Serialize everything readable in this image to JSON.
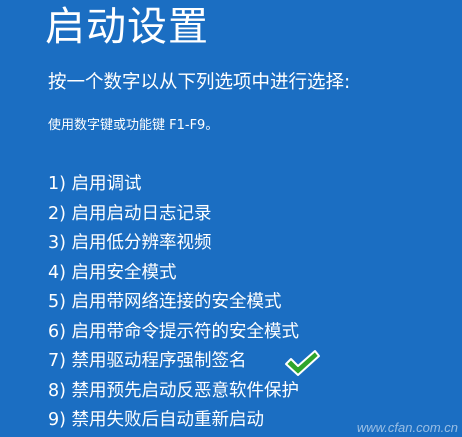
{
  "page": {
    "title": "启动设置",
    "instruction": "按一个数字以从下列选项中进行选择:",
    "key_hint": "使用数字键或功能键 F1-F9。"
  },
  "options": [
    {
      "label": "1) 启用调试"
    },
    {
      "label": "2) 启用启动日志记录"
    },
    {
      "label": "3) 启用低分辨率视频"
    },
    {
      "label": "4) 启用安全模式"
    },
    {
      "label": "5) 启用带网络连接的安全模式"
    },
    {
      "label": "6) 启用带命令提示符的安全模式"
    },
    {
      "label": "7) 禁用驱动程序强制签名"
    },
    {
      "label": "8) 禁用预先启动反恶意软件保护"
    },
    {
      "label": "9) 禁用失败后自动重新启动"
    }
  ],
  "annotation": {
    "icon": "checkmark-icon",
    "marks_option": "7) 禁用驱动程序强制签名",
    "color": "#2fa52b"
  },
  "watermark": {
    "text": "www.cfan.com.cn"
  },
  "colors": {
    "background": "#1b6ec2",
    "text": "#ffffff"
  }
}
